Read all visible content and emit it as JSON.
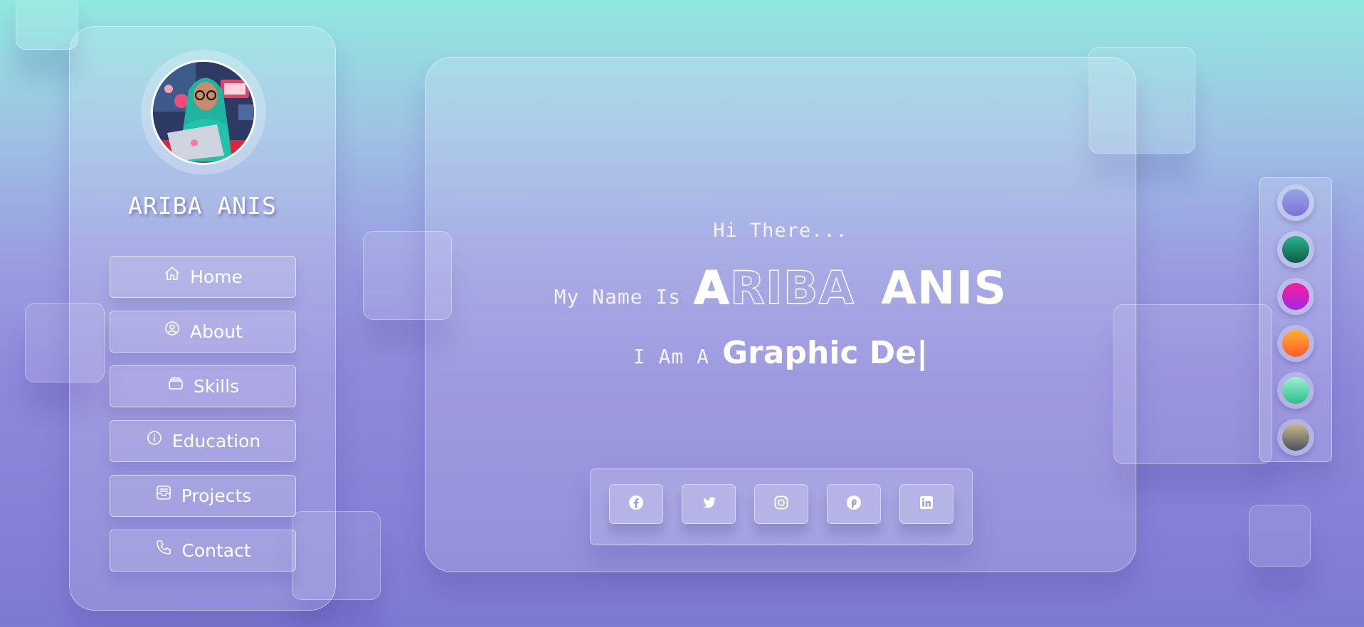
{
  "profile": {
    "name": "ARIBA ANIS"
  },
  "nav": [
    {
      "label": "Home",
      "icon": "home-icon"
    },
    {
      "label": "About",
      "icon": "user-circle-icon"
    },
    {
      "label": "Skills",
      "icon": "layers-icon"
    },
    {
      "label": "Education",
      "icon": "info-icon"
    },
    {
      "label": "Projects",
      "icon": "inbox-icon"
    },
    {
      "label": "Contact",
      "icon": "phone-icon"
    }
  ],
  "hero": {
    "greeting": "Hi There...",
    "name_prefix": "My Name Is",
    "name_first": "ARIBA",
    "name_last": "ANIS",
    "role_prefix": "I Am A",
    "role_typed": "Graphic De",
    "cursor": "|"
  },
  "social": [
    {
      "name": "facebook-icon"
    },
    {
      "name": "twitter-icon"
    },
    {
      "name": "instagram-icon"
    },
    {
      "name": "pinterest-icon"
    },
    {
      "name": "linkedin-icon"
    }
  ],
  "theme_colors": [
    {
      "name": "periwinkle",
      "from": "#9aa5e6",
      "to": "#7a72d6"
    },
    {
      "name": "emerald",
      "from": "#2bb58d",
      "to": "#0d5a49"
    },
    {
      "name": "magenta",
      "from": "#ff1aa0",
      "to": "#9b2be0"
    },
    {
      "name": "orange",
      "from": "#ffb02e",
      "to": "#ff5b2e"
    },
    {
      "name": "mint",
      "from": "#9cf0d4",
      "to": "#2dbf86"
    },
    {
      "name": "sepia",
      "from": "#c9b98b",
      "to": "#4b4f5a"
    }
  ]
}
